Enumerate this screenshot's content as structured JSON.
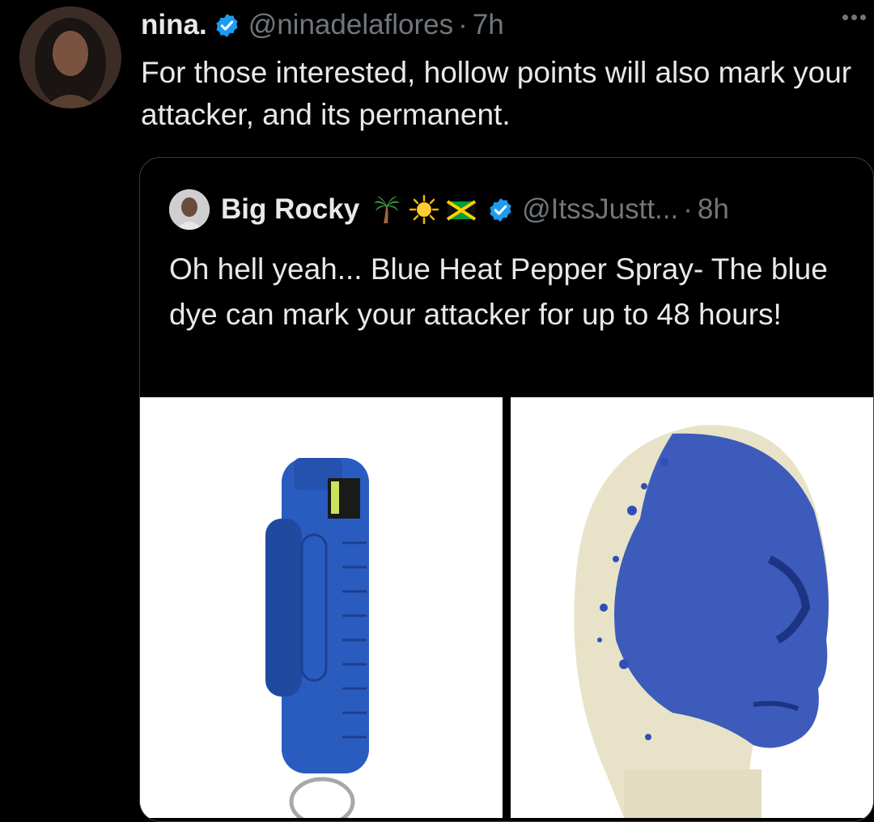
{
  "tweet": {
    "display_name": "nina.",
    "handle": "@ninadelaflores",
    "separator": "·",
    "time": "7h",
    "text": "For those interested, hollow points will also mark your attacker, and its permanent.",
    "avatar_icon": "user-avatar-photo"
  },
  "quoted": {
    "display_name": "Big Rocky",
    "emojis": [
      "palm-tree-icon",
      "sun-icon",
      "jamaica-flag-icon"
    ],
    "handle": "@ItssJustt...",
    "separator": "·",
    "time": "8h",
    "text": "Oh hell yeah... Blue Heat Pepper Spray- The blue dye can mark your attacker for up to 48 hours!",
    "media": [
      {
        "description_icon": "blue-pepper-spray-canister-image"
      },
      {
        "description_icon": "mannequin-head-blue-dye-image"
      }
    ]
  },
  "colors": {
    "background": "#000000",
    "text": "#e7e9ea",
    "muted": "#71767b",
    "verified_blue": "#1d9bf0",
    "border": "#3a3d41",
    "dye_blue": "#2e4fb8"
  }
}
